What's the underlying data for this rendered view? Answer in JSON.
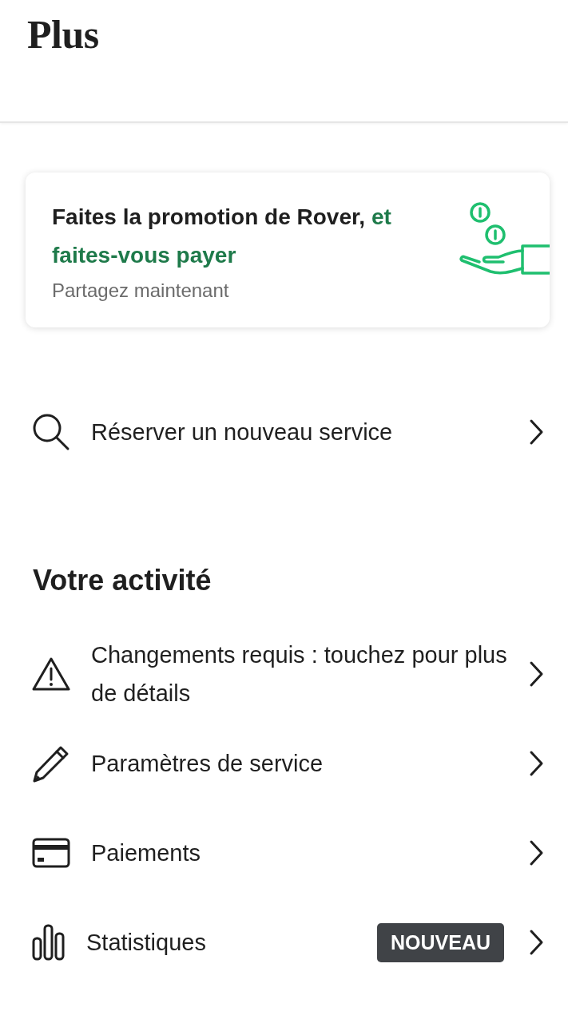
{
  "header": {
    "title": "Plus"
  },
  "promo": {
    "title": "Faites la promotion de Rover,",
    "highlight": "et faites-vous payer",
    "subtitle": "Partagez maintenant"
  },
  "search_row": {
    "label": "Réserver un nouveau service"
  },
  "section": {
    "title": "Votre activité"
  },
  "items": [
    {
      "kind": "warning",
      "label": "Changements requis : touchez pour plus de détails"
    },
    {
      "kind": "pencil",
      "label": "Paramètres de service"
    },
    {
      "kind": "card",
      "label": "Paiements"
    },
    {
      "kind": "chart",
      "label": "Statistiques",
      "badge": "NOUVEAU"
    }
  ]
}
